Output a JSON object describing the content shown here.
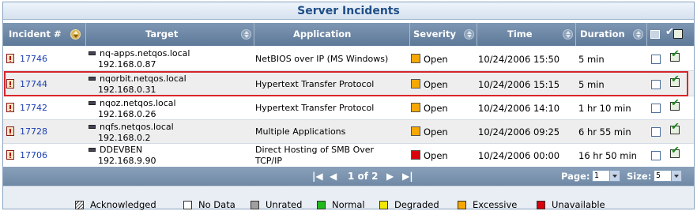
{
  "panel": {
    "title": "Server Incidents"
  },
  "columns": [
    {
      "key": "incident",
      "label": "Incident #"
    },
    {
      "key": "target",
      "label": "Target"
    },
    {
      "key": "application",
      "label": "Application"
    },
    {
      "key": "severity",
      "label": "Severity"
    },
    {
      "key": "time",
      "label": "Time"
    },
    {
      "key": "duration",
      "label": "Duration"
    }
  ],
  "colors": {
    "severity_open": "#f6a800",
    "severity_unavailable": "#d9000c",
    "selected_outline": "#d8262b"
  },
  "rows": [
    {
      "id": "17746",
      "target_name": "nq-apps.netqos.local",
      "target_ip": "192.168.0.87",
      "application": "NetBIOS over IP (MS Windows)",
      "severity": "Open",
      "severity_color": "#f6a800",
      "time": "10/24/2006 15:50",
      "duration": "5 min",
      "checked": false
    },
    {
      "id": "17744",
      "target_name": "nqorbit.netqos.local",
      "target_ip": "192.168.0.31",
      "application": "Hypertext Transfer Protocol",
      "severity": "Open",
      "severity_color": "#f6a800",
      "time": "10/24/2006 15:15",
      "duration": "5 min",
      "checked": false,
      "selected": true
    },
    {
      "id": "17742",
      "target_name": "nqoz.netqos.local",
      "target_ip": "192.168.0.26",
      "application": "Hypertext Transfer Protocol",
      "severity": "Open",
      "severity_color": "#f6a800",
      "time": "10/24/2006 14:10",
      "duration": "1 hr 10 min",
      "checked": false
    },
    {
      "id": "17728",
      "target_name": "nqfs.netqos.local",
      "target_ip": "192.168.0.2",
      "application": "Multiple Applications",
      "severity": "Open",
      "severity_color": "#f6a800",
      "time": "10/24/2006 09:25",
      "duration": "6 hr 55 min",
      "checked": false
    },
    {
      "id": "17706",
      "target_name": "DDEVBEN",
      "target_ip": "192.168.9.90",
      "application": "Direct Hosting of SMB Over TCP/IP",
      "severity": "Open",
      "severity_color": "#d9000c",
      "time": "10/24/2006 00:00",
      "duration": "16 hr 50 min",
      "checked": false
    }
  ],
  "pager": {
    "status": "1 of 2",
    "page_label": "Page:",
    "page_value": "1",
    "size_label": "Size:",
    "size_value": "5"
  },
  "legend": [
    {
      "label": "Acknowledged",
      "color": "#ffffff",
      "icon": "acknowledged-hatch-icon"
    },
    {
      "label": "No Data",
      "color": "#ffffff"
    },
    {
      "label": "Unrated",
      "color": "#a0a0a0"
    },
    {
      "label": "Normal",
      "color": "#22b81e"
    },
    {
      "label": "Degraded",
      "color": "#f0e800"
    },
    {
      "label": "Excessive",
      "color": "#f6a800"
    },
    {
      "label": "Unavailable",
      "color": "#d9000c"
    }
  ]
}
